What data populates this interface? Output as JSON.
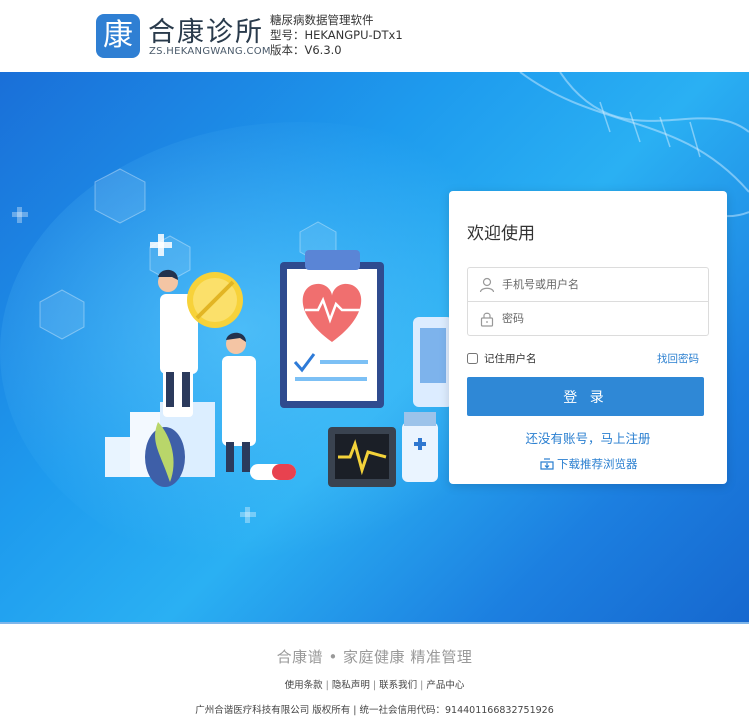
{
  "header": {
    "logo_char": "康",
    "brand_name": "合康诊所",
    "brand_domain": "ZS.HEKANGWANG.COM",
    "product_name": "糖尿病数据管理软件",
    "model": "型号：HEKANGPU-DTx1",
    "version": "版本：V6.3.0"
  },
  "login": {
    "title": "欢迎使用",
    "username_placeholder": "手机号或用户名",
    "password_placeholder": "密码",
    "remember_label": "记住用户名",
    "forgot_label": "找回密码",
    "login_button": "登 录",
    "register_link": "还没有账号，马上注册",
    "download_link": "下载推荐浏览器"
  },
  "footer": {
    "slogan": "合康谱 • 家庭健康 精准管理",
    "links": [
      "使用条款",
      "隐私声明",
      "联系我们",
      "产品中心"
    ],
    "copyright": "广州合谐医疗科技有限公司 版权所有 | 统一社会信用代码：914401166832751926"
  },
  "colors": {
    "accent": "#2f88d6",
    "link": "#2a7fd0",
    "banner_blue": "#1e9bee"
  }
}
